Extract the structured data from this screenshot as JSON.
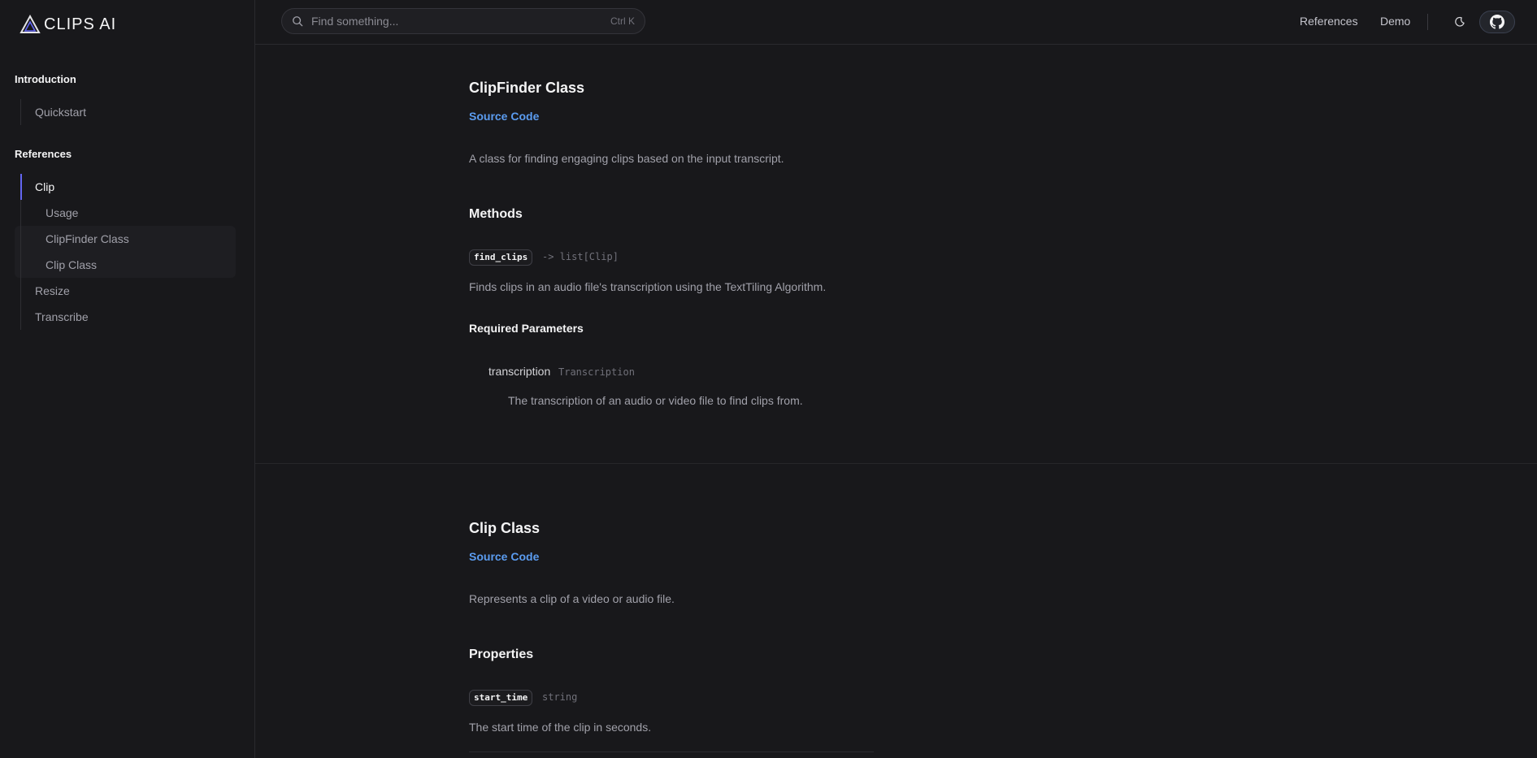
{
  "app": {
    "logo_text": "CLIPS AI"
  },
  "sidebar": {
    "sections": [
      {
        "title": "Introduction",
        "items": [
          {
            "label": "Quickstart"
          }
        ]
      },
      {
        "title": "References",
        "items": [
          {
            "label": "Clip",
            "active": true
          },
          {
            "label": "Usage"
          },
          {
            "label": "ClipFinder Class"
          },
          {
            "label": "Clip Class"
          },
          {
            "label": "Resize"
          },
          {
            "label": "Transcribe"
          }
        ]
      }
    ]
  },
  "header": {
    "search_placeholder": "Find something...",
    "search_shortcut": "Ctrl K",
    "links": [
      "References",
      "Demo"
    ],
    "theme_icon": "moon-icon",
    "github_icon": "github-icon",
    "accent_color": "#6366f1",
    "link_color": "#5b9cf0"
  },
  "main": {
    "clipfinder": {
      "title": "ClipFinder Class",
      "source_link": "Source Code",
      "description": "A class for finding engaging clips based on the input transcript.",
      "methods_heading": "Methods",
      "method": {
        "name": "find_clips",
        "returns": "-> list[Clip]",
        "description": "Finds clips in an audio file's transcription using the TextTiling Algorithm."
      },
      "required_params_heading": "Required Parameters",
      "param": {
        "name": "transcription",
        "type": "Transcription",
        "description": "The transcription of an audio or video file to find clips from."
      }
    },
    "clip": {
      "title": "Clip Class",
      "source_link": "Source Code",
      "description": "Represents a clip of a video or audio file.",
      "properties_heading": "Properties",
      "property": {
        "name": "start_time",
        "type": "string",
        "description": "The start time of the clip in seconds."
      }
    }
  }
}
